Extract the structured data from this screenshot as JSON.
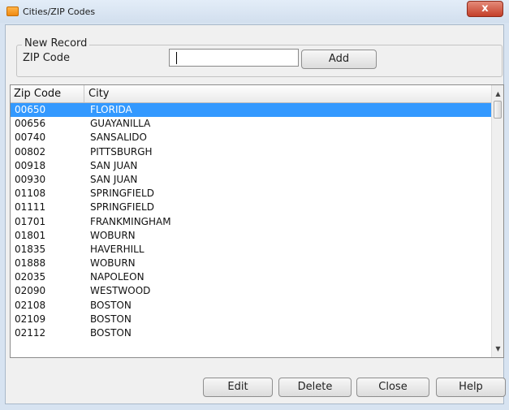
{
  "window": {
    "title": "Cities/ZIP Codes",
    "close_glyph": "x"
  },
  "new_record": {
    "group_title": "New Record",
    "zip_label": "ZIP Code",
    "zip_value": "",
    "add_label": "Add"
  },
  "grid": {
    "columns": {
      "zip": "Zip Code",
      "city": "City"
    },
    "selected_index": 0,
    "rows": [
      {
        "zip": "00650",
        "city": "FLORIDA"
      },
      {
        "zip": "00656",
        "city": "GUAYANILLA"
      },
      {
        "zip": "00740",
        "city": "SANSALIDO"
      },
      {
        "zip": "00802",
        "city": "PITTSBURGH"
      },
      {
        "zip": "00918",
        "city": "SAN JUAN"
      },
      {
        "zip": "00930",
        "city": "SAN JUAN"
      },
      {
        "zip": "01108",
        "city": "SPRINGFIELD"
      },
      {
        "zip": "01111",
        "city": "SPRINGFIELD"
      },
      {
        "zip": "01701",
        "city": "FRANKMINGHAM"
      },
      {
        "zip": "01801",
        "city": "WOBURN"
      },
      {
        "zip": "01835",
        "city": "HAVERHILL"
      },
      {
        "zip": "01888",
        "city": "WOBURN"
      },
      {
        "zip": "02035",
        "city": "NAPOLEON"
      },
      {
        "zip": "02090",
        "city": "WESTWOOD"
      },
      {
        "zip": "02108",
        "city": "BOSTON"
      },
      {
        "zip": "02109",
        "city": "BOSTON"
      },
      {
        "zip": "02112",
        "city": "BOSTON"
      }
    ]
  },
  "actions": {
    "edit": "Edit",
    "delete": "Delete",
    "close": "Close",
    "help": "Help"
  },
  "colors": {
    "selection": "#3399ff",
    "window_frame": "#d7e3f1",
    "close_button": "#c4402a"
  }
}
